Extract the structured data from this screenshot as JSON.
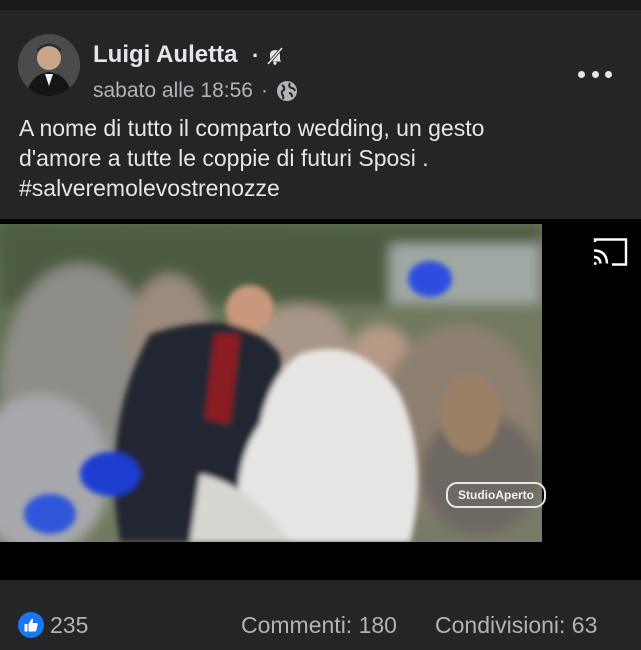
{
  "post": {
    "author": "Luigi Auletta",
    "timestamp": "sabato alle 18:56",
    "privacy_icon": "globe-icon",
    "status_icon": "muted-bell-icon",
    "text_lines": [
      "A nome di tutto il comparto wedding, un gesto",
      "d'amore a tutte le coppie di futuri Sposi .",
      "#salveremolevostrenozze"
    ]
  },
  "video": {
    "watermark": "StudioAperto",
    "cast_icon": "cast-icon"
  },
  "stats": {
    "likes": "235",
    "comments": "Commenti: 180",
    "shares": "Condivisioni: 63"
  },
  "colors": {
    "background": "#242526",
    "text": "#e4e6eb",
    "secondary_text": "#b0b3b8",
    "like_blue": "#1877f2"
  }
}
